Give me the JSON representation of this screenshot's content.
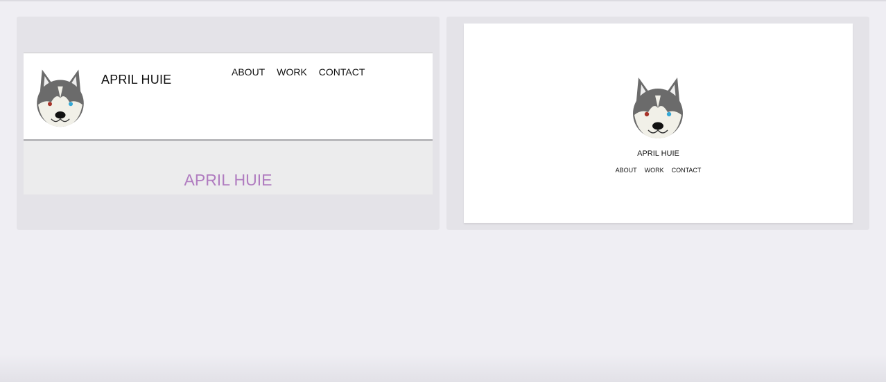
{
  "left_preview": {
    "header": {
      "site_name": "APRIL HUIE",
      "nav": [
        "ABOUT",
        "WORK",
        "CONTACT"
      ]
    },
    "hero": {
      "title": "APRIL HUIE"
    }
  },
  "right_preview": {
    "site_name": "APRIL HUIE",
    "nav": [
      "ABOUT",
      "WORK",
      "CONTACT"
    ]
  },
  "logo": {
    "icon": "husky-icon",
    "colors": {
      "fur_dark": "#6b6b6b",
      "fur_light": "#f1f0e8",
      "ear_inner": "#eeeeee",
      "eye_left": "#a8342a",
      "eye_right": "#35a8d6",
      "nose": "#111111"
    }
  },
  "accent_color": "#b07cc0"
}
